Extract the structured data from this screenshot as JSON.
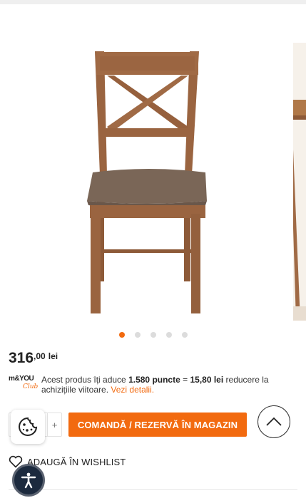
{
  "gallery": {
    "image_alt": "",
    "slide_count": 5,
    "active_slide": 0
  },
  "price": {
    "integer": "316",
    "decimals": ",00",
    "currency": "lei"
  },
  "loyalty": {
    "logo_line1": "m&YOU",
    "logo_line2": "Club",
    "text_before": "Acest produs îți aduce ",
    "points": "1.580 puncte",
    "text_equals": " = ",
    "amount": "15,80 lei",
    "text_after": " reducere la achizițiile viitoare. ",
    "details_link": "Vezi detalii."
  },
  "quantity": {
    "plus_label": "+"
  },
  "actions": {
    "order_label": "COMANDĂ / REZERVĂ ÎN MAGAZIN",
    "wishlist_label": "ADAUGĂ ÎN WISHLIST"
  },
  "colors": {
    "accent": "#f26a0f",
    "wood": "#9a6440",
    "seat": "#7a6657",
    "a11y_bg": "#1c2a3e"
  },
  "icons": {
    "cookie": "cookie-icon",
    "scroll_top": "chevron-up-icon",
    "wishlist": "heart-icon",
    "accessibility": "accessibility-icon"
  }
}
